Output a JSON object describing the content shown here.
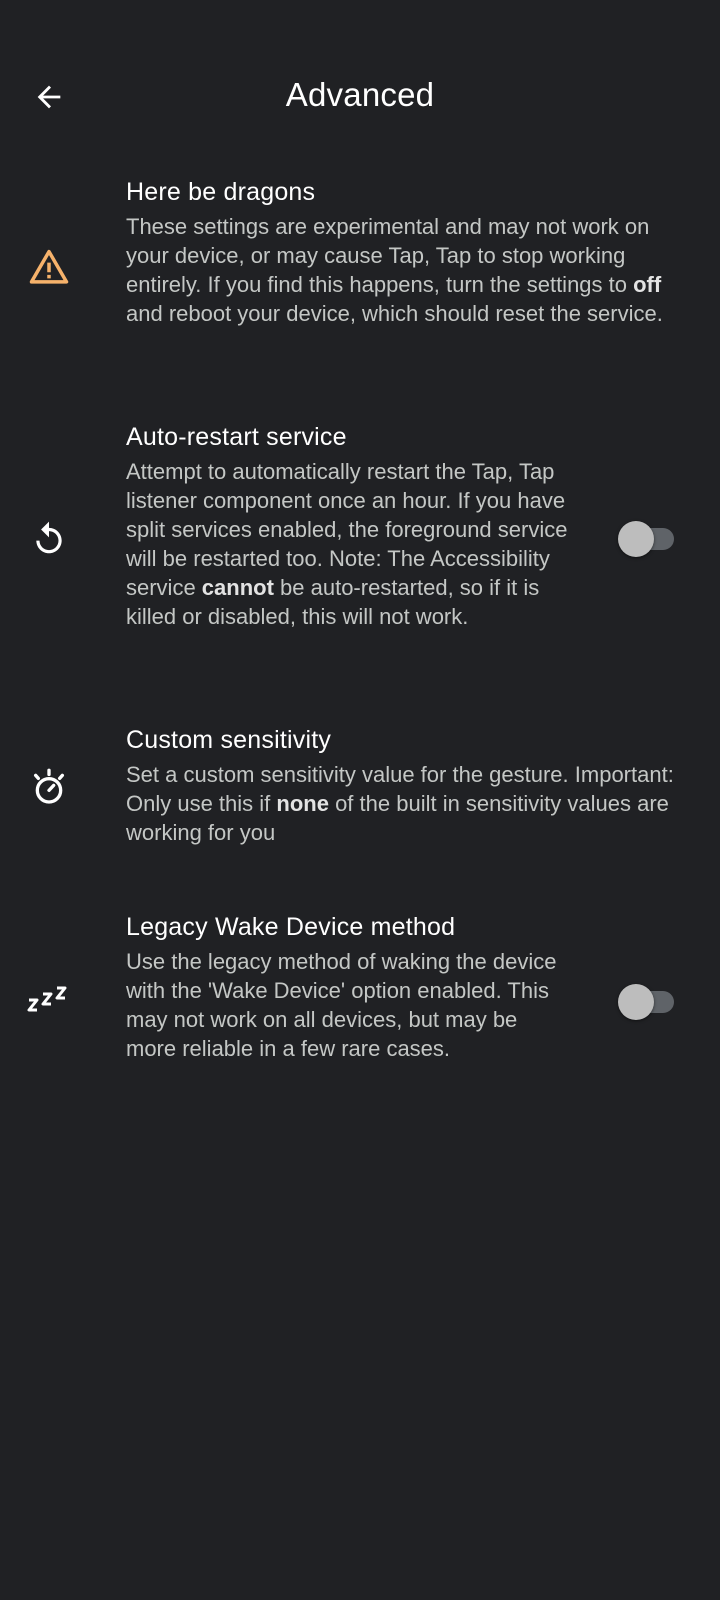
{
  "header": {
    "title": "Advanced"
  },
  "rows": [
    {
      "title": "Here be dragons",
      "summary_parts": [
        "These settings are experimental and may not work on your device, or may cause Tap, Tap to stop working entirely. If you find this happens, turn the settings to ",
        "off",
        " and reboot your device, which should reset the service."
      ],
      "icon": "warning-icon",
      "icon_color": "#F6B26B"
    },
    {
      "title": "Auto-restart service",
      "summary_parts": [
        "Attempt to automatically restart the Tap, Tap listener component once an hour. If you have split services enabled, the foreground service will be restarted too. Note: The Accessibility service ",
        "cannot",
        " be auto-restarted, so if it is killed or disabled, this will not work."
      ],
      "icon": "restart-icon",
      "toggle_on": false
    },
    {
      "title": "Custom sensitivity",
      "summary_parts": [
        "Set a custom sensitivity value for the gesture. Important: Only use this if ",
        "none",
        " of the built in sensitivity values are working for you"
      ],
      "icon": "timer-icon"
    },
    {
      "title": "Legacy Wake Device method",
      "summary": "Use the legacy method of waking the device with the 'Wake Device' option enabled. This may not work on all devices, but may be more reliable in a few rare cases.",
      "icon": "sleep-zzz-icon",
      "toggle_on": false
    }
  ],
  "colors": {
    "background": "#202124",
    "title_text": "#FFFFFF",
    "summary_text": "#C4C7C5",
    "warning": "#F6B26B",
    "switch_track": "#5F6368",
    "switch_thumb": "#BDBDBD"
  }
}
